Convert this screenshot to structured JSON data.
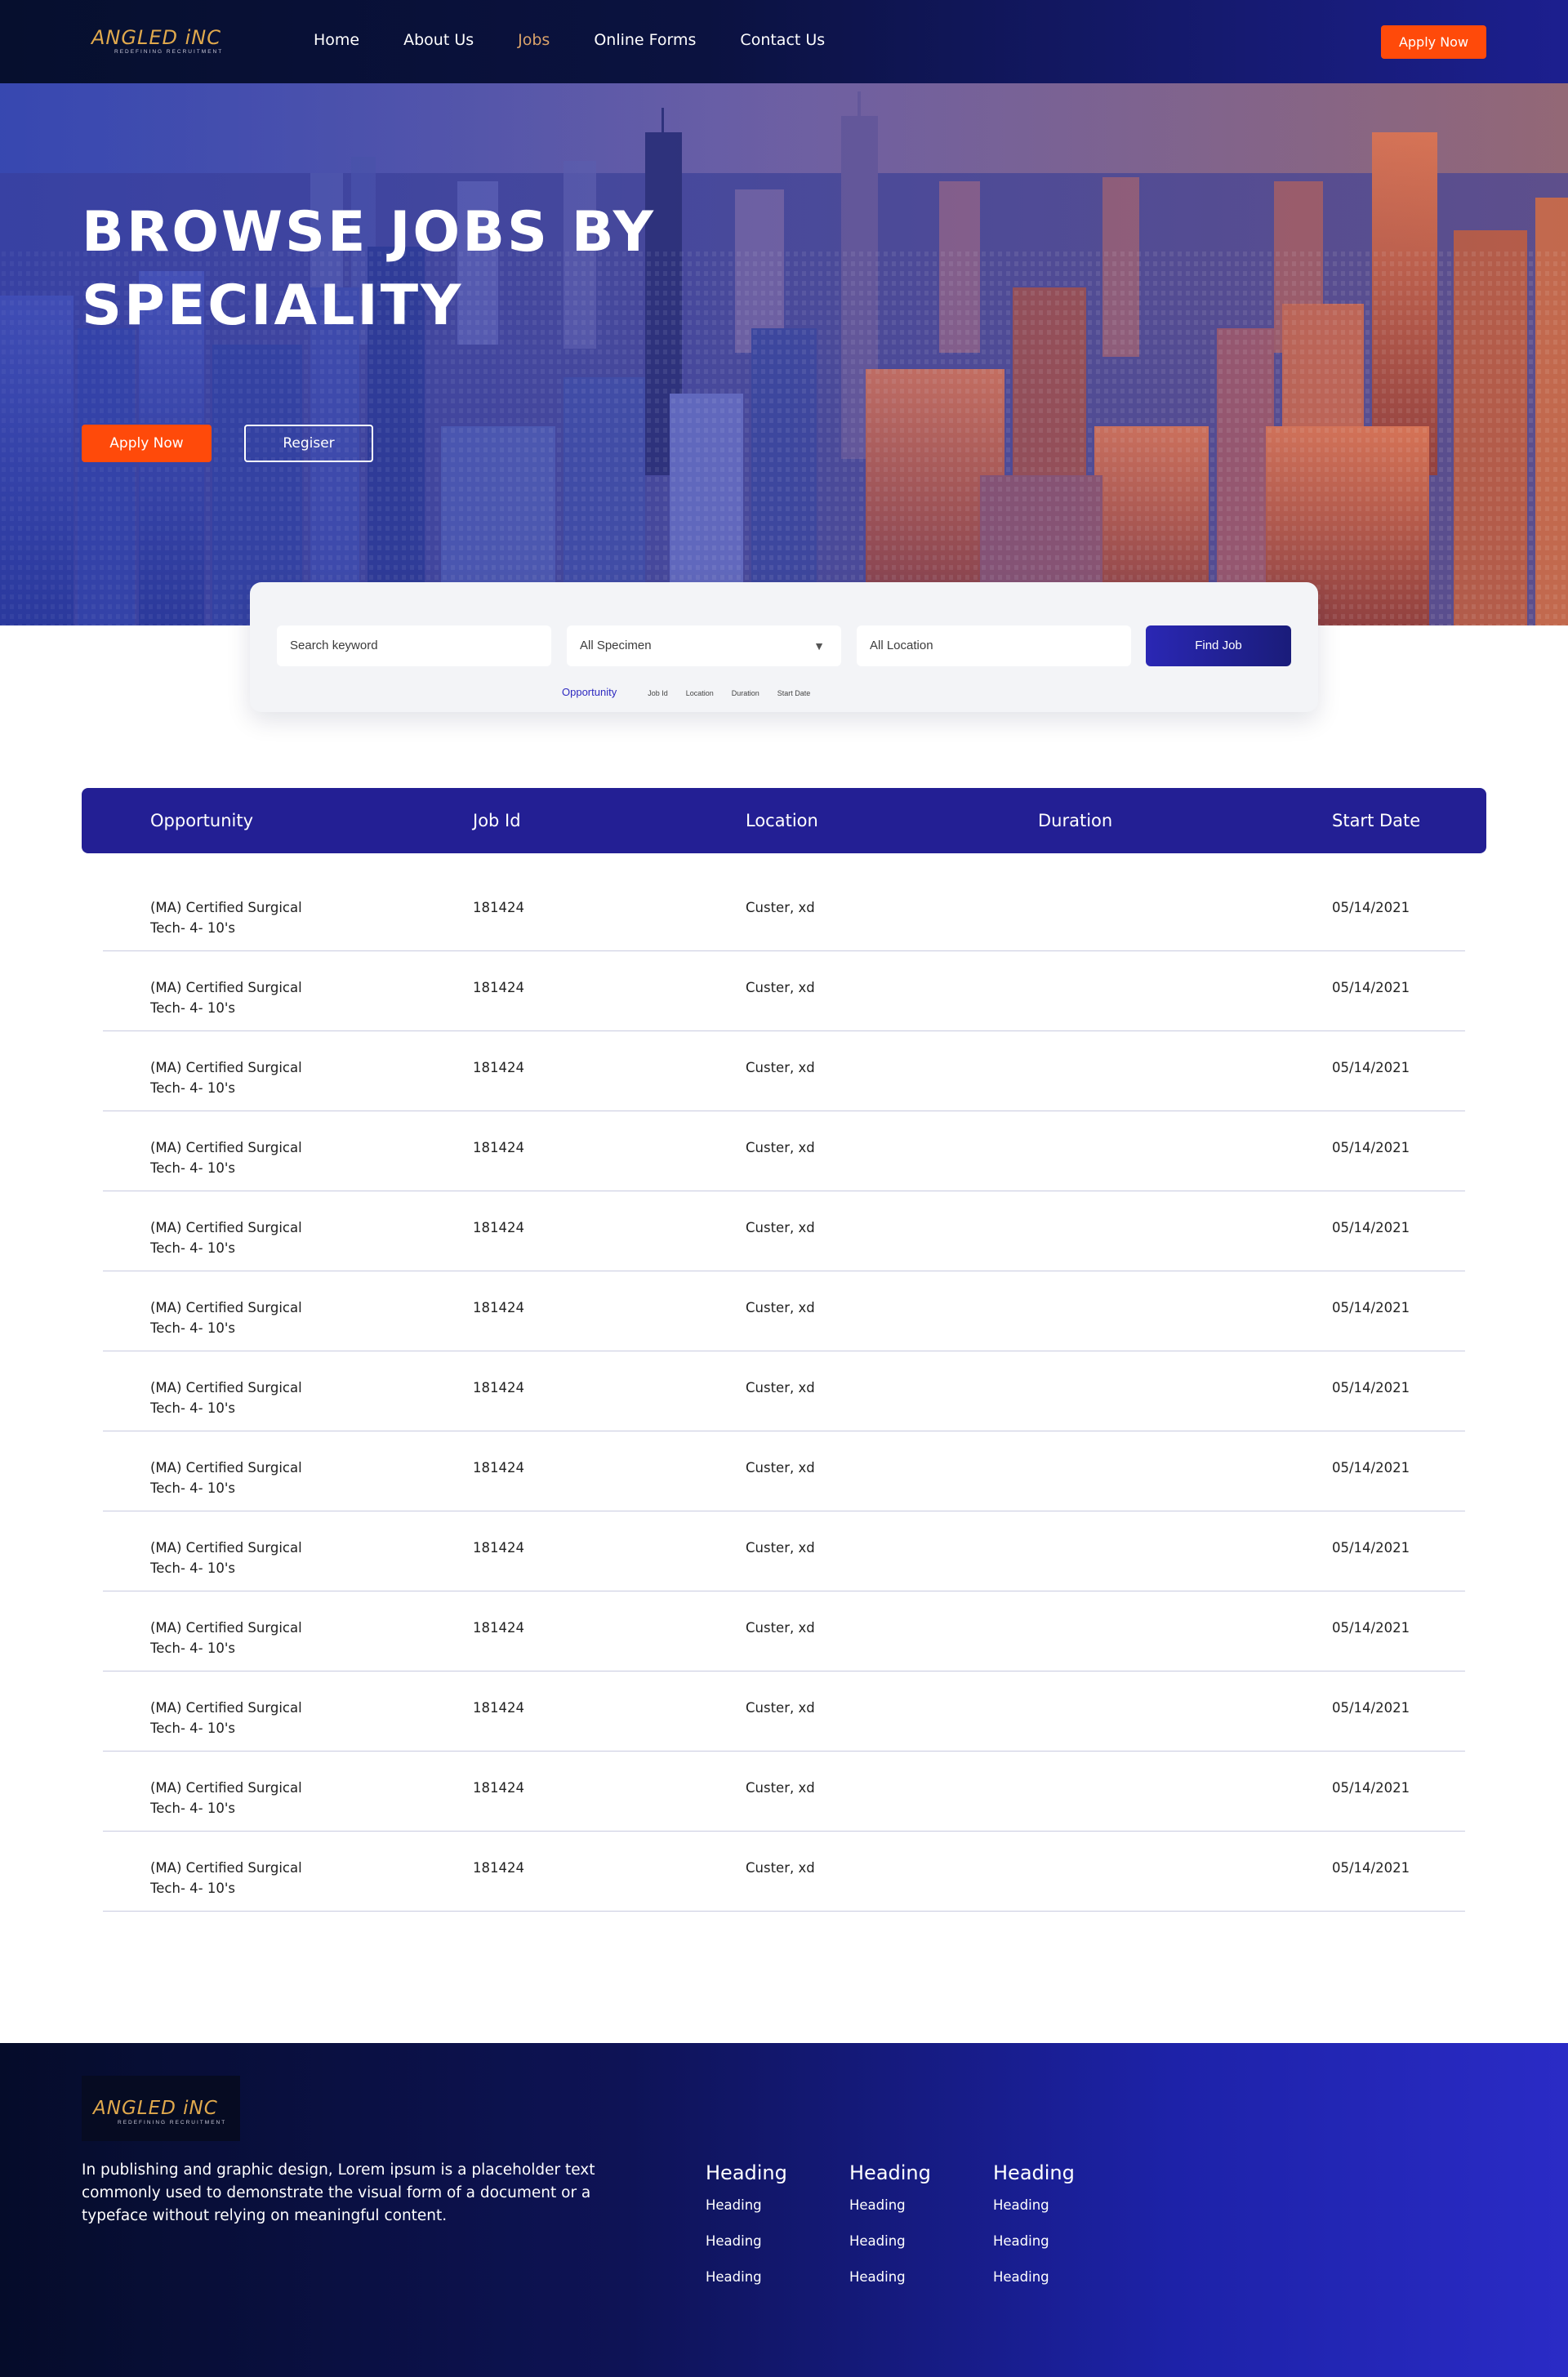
{
  "brand": {
    "name": "ANGLED iNC",
    "tagline": "REDEFINING RECRUITMENT"
  },
  "nav": {
    "items": [
      "Home",
      "About Us",
      "Jobs",
      "Online Forms",
      "Contact Us"
    ],
    "active": "Jobs",
    "apply_label": "Apply Now"
  },
  "hero": {
    "title_line1": "BROWSE JOBS BY",
    "title_line2": "SPECIALITY",
    "apply_label": "Apply Now",
    "register_label": "Regiser"
  },
  "search": {
    "keyword_placeholder": "Search keyword",
    "specimen_value": "All Specimen",
    "location_placeholder": "All Location",
    "find_label": "Find Job",
    "filters": [
      "Opportunity",
      "Job Id",
      "Location",
      "Duration",
      "Start Date"
    ],
    "active_filter": "Opportunity"
  },
  "table": {
    "columns": [
      "Opportunity",
      "Job Id",
      "Location",
      "Duration",
      "Start Date"
    ],
    "rows": [
      {
        "opportunity_l1": "(MA) Certified Surgical",
        "opportunity_l2": "Tech- 4- 10's",
        "job_id": "181424",
        "location": "Custer, xd",
        "duration": "",
        "start_date": "05/14/2021"
      },
      {
        "opportunity_l1": "(MA) Certified Surgical",
        "opportunity_l2": "Tech- 4- 10's",
        "job_id": "181424",
        "location": "Custer, xd",
        "duration": "",
        "start_date": "05/14/2021"
      },
      {
        "opportunity_l1": "(MA) Certified Surgical",
        "opportunity_l2": "Tech- 4- 10's",
        "job_id": "181424",
        "location": "Custer, xd",
        "duration": "",
        "start_date": "05/14/2021"
      },
      {
        "opportunity_l1": "(MA) Certified Surgical",
        "opportunity_l2": "Tech- 4- 10's",
        "job_id": "181424",
        "location": "Custer, xd",
        "duration": "",
        "start_date": "05/14/2021"
      },
      {
        "opportunity_l1": "(MA) Certified Surgical",
        "opportunity_l2": "Tech- 4- 10's",
        "job_id": "181424",
        "location": "Custer, xd",
        "duration": "",
        "start_date": "05/14/2021"
      },
      {
        "opportunity_l1": "(MA) Certified Surgical",
        "opportunity_l2": "Tech- 4- 10's",
        "job_id": "181424",
        "location": "Custer, xd",
        "duration": "",
        "start_date": "05/14/2021"
      },
      {
        "opportunity_l1": "(MA) Certified Surgical",
        "opportunity_l2": "Tech- 4- 10's",
        "job_id": "181424",
        "location": "Custer, xd",
        "duration": "",
        "start_date": "05/14/2021"
      },
      {
        "opportunity_l1": "(MA) Certified Surgical",
        "opportunity_l2": "Tech- 4- 10's",
        "job_id": "181424",
        "location": "Custer, xd",
        "duration": "",
        "start_date": "05/14/2021"
      },
      {
        "opportunity_l1": "(MA) Certified Surgical",
        "opportunity_l2": "Tech- 4- 10's",
        "job_id": "181424",
        "location": "Custer, xd",
        "duration": "",
        "start_date": "05/14/2021"
      },
      {
        "opportunity_l1": "(MA) Certified Surgical",
        "opportunity_l2": "Tech- 4- 10's",
        "job_id": "181424",
        "location": "Custer, xd",
        "duration": "",
        "start_date": "05/14/2021"
      },
      {
        "opportunity_l1": "(MA) Certified Surgical",
        "opportunity_l2": "Tech- 4- 10's",
        "job_id": "181424",
        "location": "Custer, xd",
        "duration": "",
        "start_date": "05/14/2021"
      },
      {
        "opportunity_l1": "(MA) Certified Surgical",
        "opportunity_l2": "Tech- 4- 10's",
        "job_id": "181424",
        "location": "Custer, xd",
        "duration": "",
        "start_date": "05/14/2021"
      },
      {
        "opportunity_l1": "(MA) Certified Surgical",
        "opportunity_l2": "Tech- 4- 10's",
        "job_id": "181424",
        "location": "Custer, xd",
        "duration": "",
        "start_date": "05/14/2021"
      }
    ]
  },
  "footer": {
    "text": "In publishing and graphic design, Lorem ipsum is a placeholder text commonly used to demonstrate the visual form of a document or a typeface without relying on meaningful content.",
    "columns": [
      {
        "heading": "Heading",
        "links": [
          "Heading",
          "Heading",
          "Heading"
        ]
      },
      {
        "heading": "Heading",
        "links": [
          "Heading",
          "Heading",
          "Heading"
        ]
      },
      {
        "heading": "Heading",
        "links": [
          "Heading",
          "Heading",
          "Heading"
        ]
      }
    ]
  },
  "colors": {
    "accent_orange": "#ff4a0a",
    "primary_blue": "#231f94",
    "nav_active": "#d9a26a",
    "header_dark": "#060f2e"
  }
}
